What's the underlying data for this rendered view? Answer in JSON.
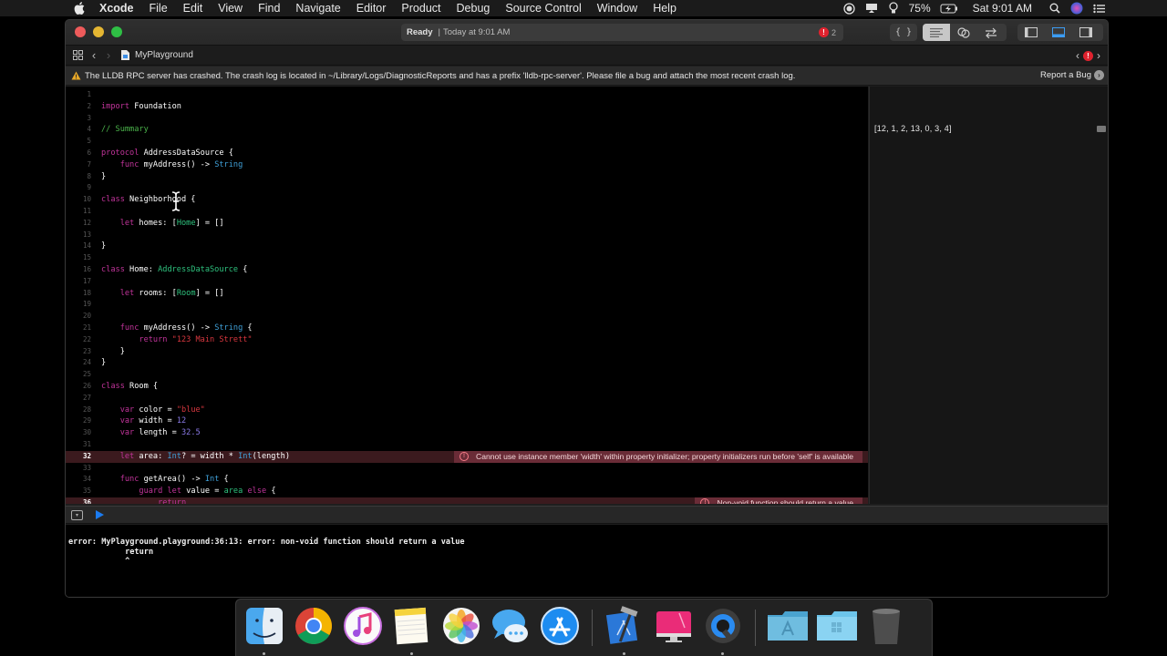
{
  "menubar": {
    "app_name": "Xcode",
    "items": [
      "File",
      "Edit",
      "View",
      "Find",
      "Navigate",
      "Editor",
      "Product",
      "Debug",
      "Source Control",
      "Window",
      "Help"
    ],
    "status": {
      "battery": "75%",
      "clock": "Sat 9:01 AM"
    }
  },
  "window": {
    "activity": {
      "status": "Ready",
      "separator": "|",
      "time": "Today at 9:01 AM",
      "error_count": "2"
    },
    "path": {
      "file": "MyPlayground"
    },
    "warning": {
      "message": "The LLDB RPC server has crashed. The crash log is located in ~/Library/Logs/DiagnosticReports and has a prefix 'lldb-rpc-server'. Please file a bug and attach the most recent crash log.",
      "action": "Report a Bug"
    }
  },
  "editor": {
    "lines": [
      {
        "n": "1",
        "tokens": []
      },
      {
        "n": "2",
        "tokens": [
          [
            "kw",
            "import"
          ],
          [
            "",
            "Foundation"
          ]
        ]
      },
      {
        "n": "3",
        "tokens": []
      },
      {
        "n": "4",
        "tokens": [
          [
            "cmt",
            "// Summary"
          ]
        ]
      },
      {
        "n": "5",
        "tokens": []
      },
      {
        "n": "6",
        "tokens": [
          [
            "kw",
            "protocol"
          ],
          [
            "",
            " AddressDataSource {"
          ]
        ]
      },
      {
        "n": "7",
        "tokens": [
          [
            "",
            "    "
          ],
          [
            "kw",
            "func"
          ],
          [
            "",
            " myAddress() -> "
          ],
          [
            "sty",
            "String"
          ]
        ]
      },
      {
        "n": "8",
        "tokens": [
          [
            "",
            "}"
          ]
        ]
      },
      {
        "n": "9",
        "tokens": []
      },
      {
        "n": "10",
        "tokens": [
          [
            "kw",
            "class"
          ],
          [
            "",
            " Neighborhood {"
          ]
        ]
      },
      {
        "n": "11",
        "tokens": []
      },
      {
        "n": "12",
        "tokens": [
          [
            "",
            "    "
          ],
          [
            "kw",
            "let"
          ],
          [
            "",
            " homes: ["
          ],
          [
            "ty",
            "Home"
          ],
          [
            "",
            "] = []"
          ]
        ]
      },
      {
        "n": "13",
        "tokens": []
      },
      {
        "n": "14",
        "tokens": [
          [
            "",
            "}"
          ]
        ]
      },
      {
        "n": "15",
        "tokens": []
      },
      {
        "n": "16",
        "tokens": [
          [
            "kw",
            "class"
          ],
          [
            "",
            " Home: "
          ],
          [
            "ty",
            "AddressDataSource"
          ],
          [
            "",
            " {"
          ]
        ]
      },
      {
        "n": "17",
        "tokens": []
      },
      {
        "n": "18",
        "tokens": [
          [
            "",
            "    "
          ],
          [
            "kw",
            "let"
          ],
          [
            "",
            " rooms: ["
          ],
          [
            "ty",
            "Room"
          ],
          [
            "",
            "] = []"
          ]
        ]
      },
      {
        "n": "19",
        "tokens": []
      },
      {
        "n": "20",
        "tokens": []
      },
      {
        "n": "21",
        "tokens": [
          [
            "",
            "    "
          ],
          [
            "kw",
            "func"
          ],
          [
            "",
            " myAddress() -> "
          ],
          [
            "sty",
            "String"
          ],
          [
            "",
            " {"
          ]
        ]
      },
      {
        "n": "22",
        "tokens": [
          [
            "",
            "        "
          ],
          [
            "kw",
            "return"
          ],
          [
            "",
            " "
          ],
          [
            "str",
            "\"123 Main Strett\""
          ]
        ]
      },
      {
        "n": "23",
        "tokens": [
          [
            "",
            "    }"
          ]
        ]
      },
      {
        "n": "24",
        "tokens": [
          [
            "",
            "}"
          ]
        ]
      },
      {
        "n": "25",
        "tokens": []
      },
      {
        "n": "26",
        "tokens": [
          [
            "kw",
            "class"
          ],
          [
            "",
            " Room {"
          ]
        ]
      },
      {
        "n": "27",
        "tokens": []
      },
      {
        "n": "28",
        "tokens": [
          [
            "",
            "    "
          ],
          [
            "kw",
            "var"
          ],
          [
            "",
            " color = "
          ],
          [
            "str",
            "\"blue\""
          ]
        ]
      },
      {
        "n": "29",
        "tokens": [
          [
            "",
            "    "
          ],
          [
            "kw",
            "var"
          ],
          [
            "",
            " width = "
          ],
          [
            "num",
            "12"
          ]
        ]
      },
      {
        "n": "30",
        "tokens": [
          [
            "",
            "    "
          ],
          [
            "kw",
            "var"
          ],
          [
            "",
            " length = "
          ],
          [
            "num",
            "32.5"
          ]
        ]
      },
      {
        "n": "31",
        "tokens": []
      },
      {
        "n": "32",
        "tokens": [
          [
            "",
            "    "
          ],
          [
            "kw",
            "let"
          ],
          [
            "",
            " area: "
          ],
          [
            "sty",
            "Int"
          ],
          [
            "",
            "? = width * "
          ],
          [
            "sty",
            "Int"
          ],
          [
            "",
            "(length)"
          ]
        ],
        "error": "Cannot use instance member 'width' within property initializer; property initializers run before 'self' is available"
      },
      {
        "n": "33",
        "tokens": []
      },
      {
        "n": "34",
        "tokens": [
          [
            "",
            "    "
          ],
          [
            "kw",
            "func"
          ],
          [
            "",
            " getArea() -> "
          ],
          [
            "sty",
            "Int"
          ],
          [
            "",
            " {"
          ]
        ]
      },
      {
        "n": "35",
        "tokens": [
          [
            "",
            "        "
          ],
          [
            "kw",
            "guard"
          ],
          [
            "",
            " "
          ],
          [
            "kw",
            "let"
          ],
          [
            "",
            " value = "
          ],
          [
            "ty",
            "area"
          ],
          [
            "",
            " "
          ],
          [
            "kw",
            "else"
          ],
          [
            "",
            " {"
          ]
        ]
      },
      {
        "n": "36",
        "tokens": [
          [
            "",
            "            "
          ],
          [
            "kw",
            "return"
          ]
        ],
        "error": "Non-void function should return a value"
      }
    ]
  },
  "results": {
    "line_value": "[12, 1, 2, 13, 0, 3, 4]"
  },
  "console": {
    "output": "error: MyPlayground.playground:36:13: error: non-void function should return a value\n            return\n            ^"
  },
  "dock": {
    "apps": [
      {
        "name": "Finder",
        "icon": "finder-icon",
        "running": true
      },
      {
        "name": "Google Chrome",
        "icon": "chrome-icon",
        "running": false
      },
      {
        "name": "iTunes",
        "icon": "itunes-icon",
        "running": false
      },
      {
        "name": "Notes",
        "icon": "notes-icon",
        "running": true
      },
      {
        "name": "Photos",
        "icon": "photos-icon",
        "running": false
      },
      {
        "name": "Messages",
        "icon": "messages-icon",
        "running": false
      },
      {
        "name": "App Store",
        "icon": "app-store-icon",
        "running": false
      },
      {
        "name": "Xcode",
        "icon": "xcode-icon",
        "running": true
      },
      {
        "name": "CleanMyMac",
        "icon": "cleanmymac-icon",
        "running": false
      },
      {
        "name": "QuickTime Player",
        "icon": "quicktime-icon",
        "running": true
      },
      {
        "name": "Applications",
        "icon": "applications-folder-icon",
        "running": false
      },
      {
        "name": "Windows Folder",
        "icon": "windows-folder-icon",
        "running": false
      },
      {
        "name": "Trash",
        "icon": "trash-icon",
        "running": false
      }
    ]
  },
  "colors": {
    "keyword": "#c2349b",
    "type": "#2ec27e",
    "system_type": "#3fa0d8",
    "string": "#d8373f",
    "number": "#8a79e6",
    "comment": "#4bb34b",
    "error_bg": "#6a2c37",
    "accent": "#1b7bf0"
  }
}
